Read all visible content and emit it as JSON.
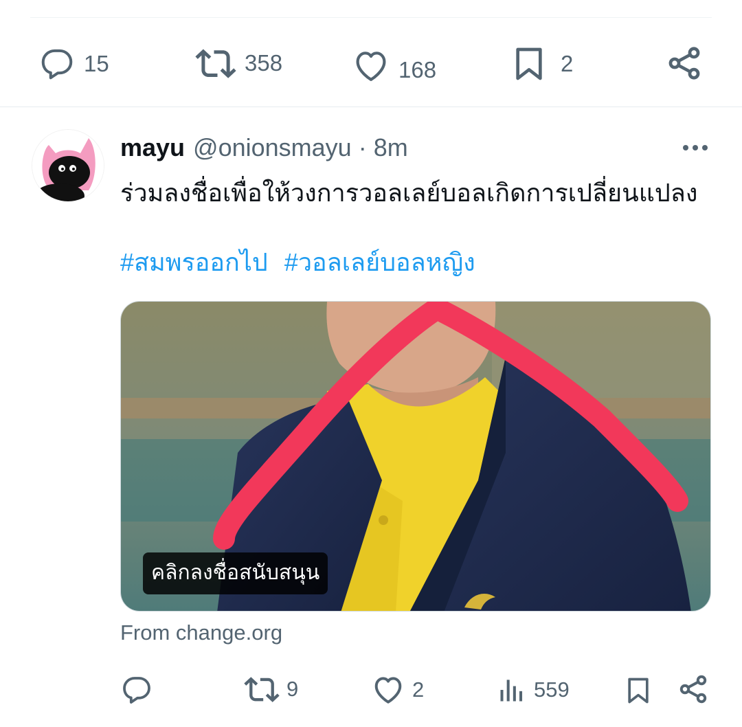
{
  "prev_tweet": {
    "reply_count": "15",
    "retweet_count": "358",
    "like_count": "168",
    "bookmark_count": "2"
  },
  "tweet": {
    "display_name": "mayu",
    "handle": "@onionsmayu",
    "separator": "·",
    "time": "8m",
    "text": "ร่วมลงชื่อเพื่อให้วงการวอลเลย์บอลเกิดการเปลี่ยนแปลง",
    "hashtags": [
      "#สมพรออกไป",
      "#วอลเลย์บอลหญิง"
    ],
    "card": {
      "caption": "คลิกลงชื่อสนับสนุน",
      "source": "From change.org"
    },
    "reply_count": "",
    "retweet_count": "9",
    "like_count": "2",
    "view_count": "559",
    "icons": [
      "reply-icon",
      "retweet-icon",
      "like-icon",
      "views-icon",
      "bookmark-icon",
      "share-icon",
      "more-icon"
    ]
  },
  "colors": {
    "link": "#1d9bf0",
    "secondary_text": "#536471",
    "card_overlay_stroke": "#f2385a",
    "jacket": "#1f2a48",
    "shirt": "#f0d22b"
  }
}
